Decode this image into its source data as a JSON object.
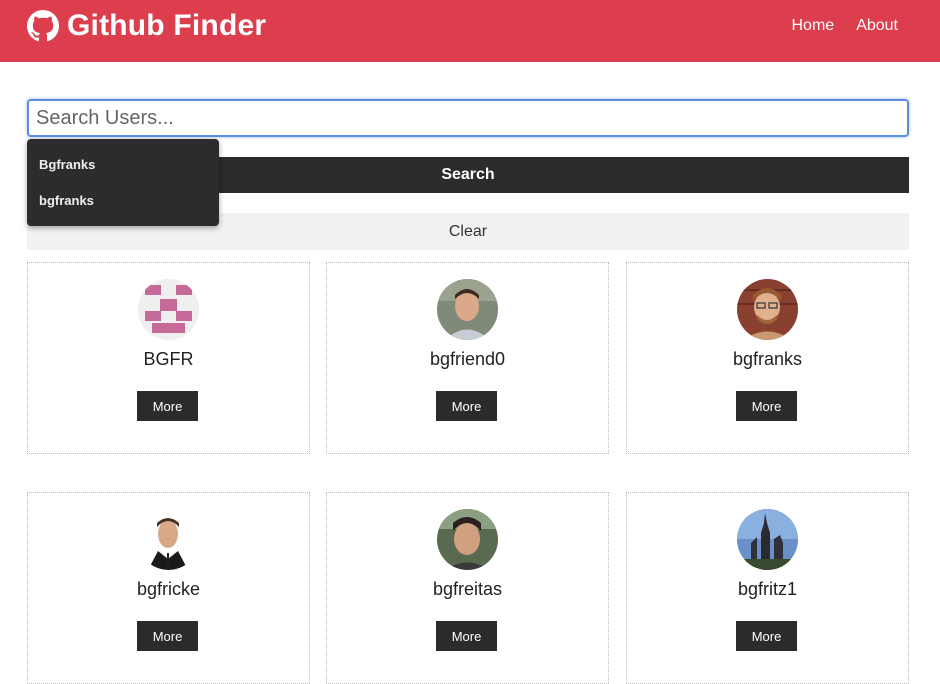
{
  "navbar": {
    "title": "Github Finder",
    "icon": "github-icon",
    "links": [
      {
        "label": "Home"
      },
      {
        "label": "About"
      }
    ]
  },
  "search": {
    "placeholder": "Search Users...",
    "value": "",
    "button_label": "Search",
    "clear_label": "Clear",
    "autocomplete": [
      {
        "label": "Bgfranks"
      },
      {
        "label": "bgfranks"
      }
    ]
  },
  "users": [
    {
      "login": "BGFR",
      "more_label": "More"
    },
    {
      "login": "bgfriend0",
      "more_label": "More"
    },
    {
      "login": "bgfranks",
      "more_label": "More"
    },
    {
      "login": "bgfricke",
      "more_label": "More"
    },
    {
      "login": "bgfreitas",
      "more_label": "More"
    },
    {
      "login": "bgfritz1",
      "more_label": "More"
    }
  ],
  "colors": {
    "navbar": "#dc3e4e",
    "dark_button": "#2b2b2b",
    "light_button": "#f1f1f1",
    "focus": "#5a8fe0"
  }
}
